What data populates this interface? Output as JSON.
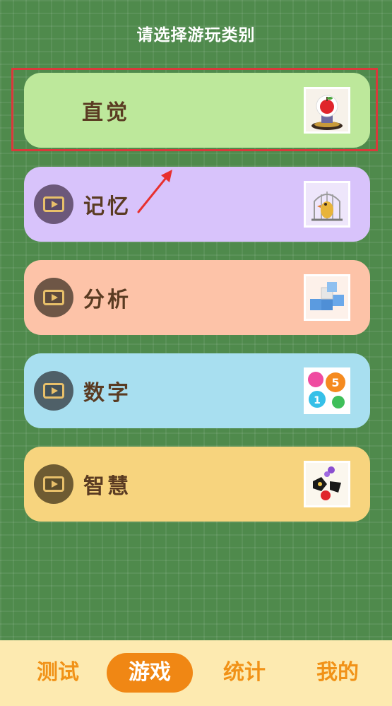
{
  "header": {
    "title": "请选择游玩类别"
  },
  "categories": [
    {
      "label": "直觉",
      "bg": "#bde89b",
      "thumb": "apple-on-stand-icon",
      "has_play": false
    },
    {
      "label": "记忆",
      "bg": "#d8c3fb",
      "thumb": "bird-in-cage-icon",
      "has_play": true,
      "play_color": "#6c587a"
    },
    {
      "label": "分析",
      "bg": "#fdc3a8",
      "thumb": "blue-cubes-icon",
      "has_play": true,
      "play_color": "#6e5646"
    },
    {
      "label": "数字",
      "bg": "#a8dff0",
      "thumb": "number-balloons-icon",
      "has_play": true,
      "play_color": "#4f6068"
    },
    {
      "label": "智慧",
      "bg": "#f7d47e",
      "thumb": "shapes-puzzle-icon",
      "has_play": true,
      "play_color": "#6e5b32"
    }
  ],
  "annotation": {
    "highlight_color": "#d9393b",
    "arrow_color": "#e8302e"
  },
  "tabbar": {
    "items": [
      {
        "label": "测试",
        "active": false
      },
      {
        "label": "游戏",
        "active": true
      },
      {
        "label": "统计",
        "active": false
      },
      {
        "label": "我的",
        "active": false
      }
    ],
    "active_bg": "#f08714",
    "text_color": "#f19217"
  }
}
